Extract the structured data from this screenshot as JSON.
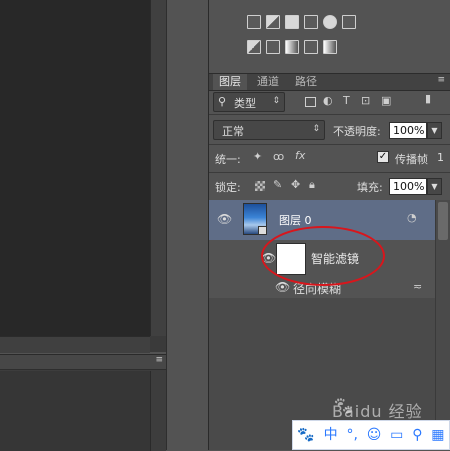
{
  "layers_panel": {
    "tabs": [
      {
        "label": "图层",
        "active": true
      },
      {
        "label": "通道",
        "active": false
      },
      {
        "label": "路径",
        "active": false
      }
    ],
    "menu_icon": "≡",
    "filter_kind_label": "类型",
    "blend_mode": "正常",
    "opacity_label": "不透明度:",
    "opacity_value": "100%",
    "unify_label": "统一:",
    "propagate_label": "传播帧",
    "propagate_value": "1",
    "propagate_checked": true,
    "lock_label": "锁定:",
    "fill_label": "填充:",
    "fill_value": "100%",
    "layers": [
      {
        "name": "图层 0",
        "selected": true
      },
      {
        "name": "智能滤镜",
        "selected": false
      },
      {
        "name": "径向模糊",
        "selected": false
      }
    ]
  },
  "annotation": {
    "color": "#d8161c"
  },
  "watermark": {
    "text": "Baidu 经验"
  },
  "ime_toolbar": {
    "items": [
      "🐾",
      "中",
      "°,",
      "☺",
      "▭",
      "⚲",
      "▦"
    ]
  },
  "colors": {
    "panel_bg": "#535353",
    "selected_layer_bg": "#5f6d87",
    "canvas_bg": "#282828",
    "ime_accent": "#2b79ff"
  }
}
